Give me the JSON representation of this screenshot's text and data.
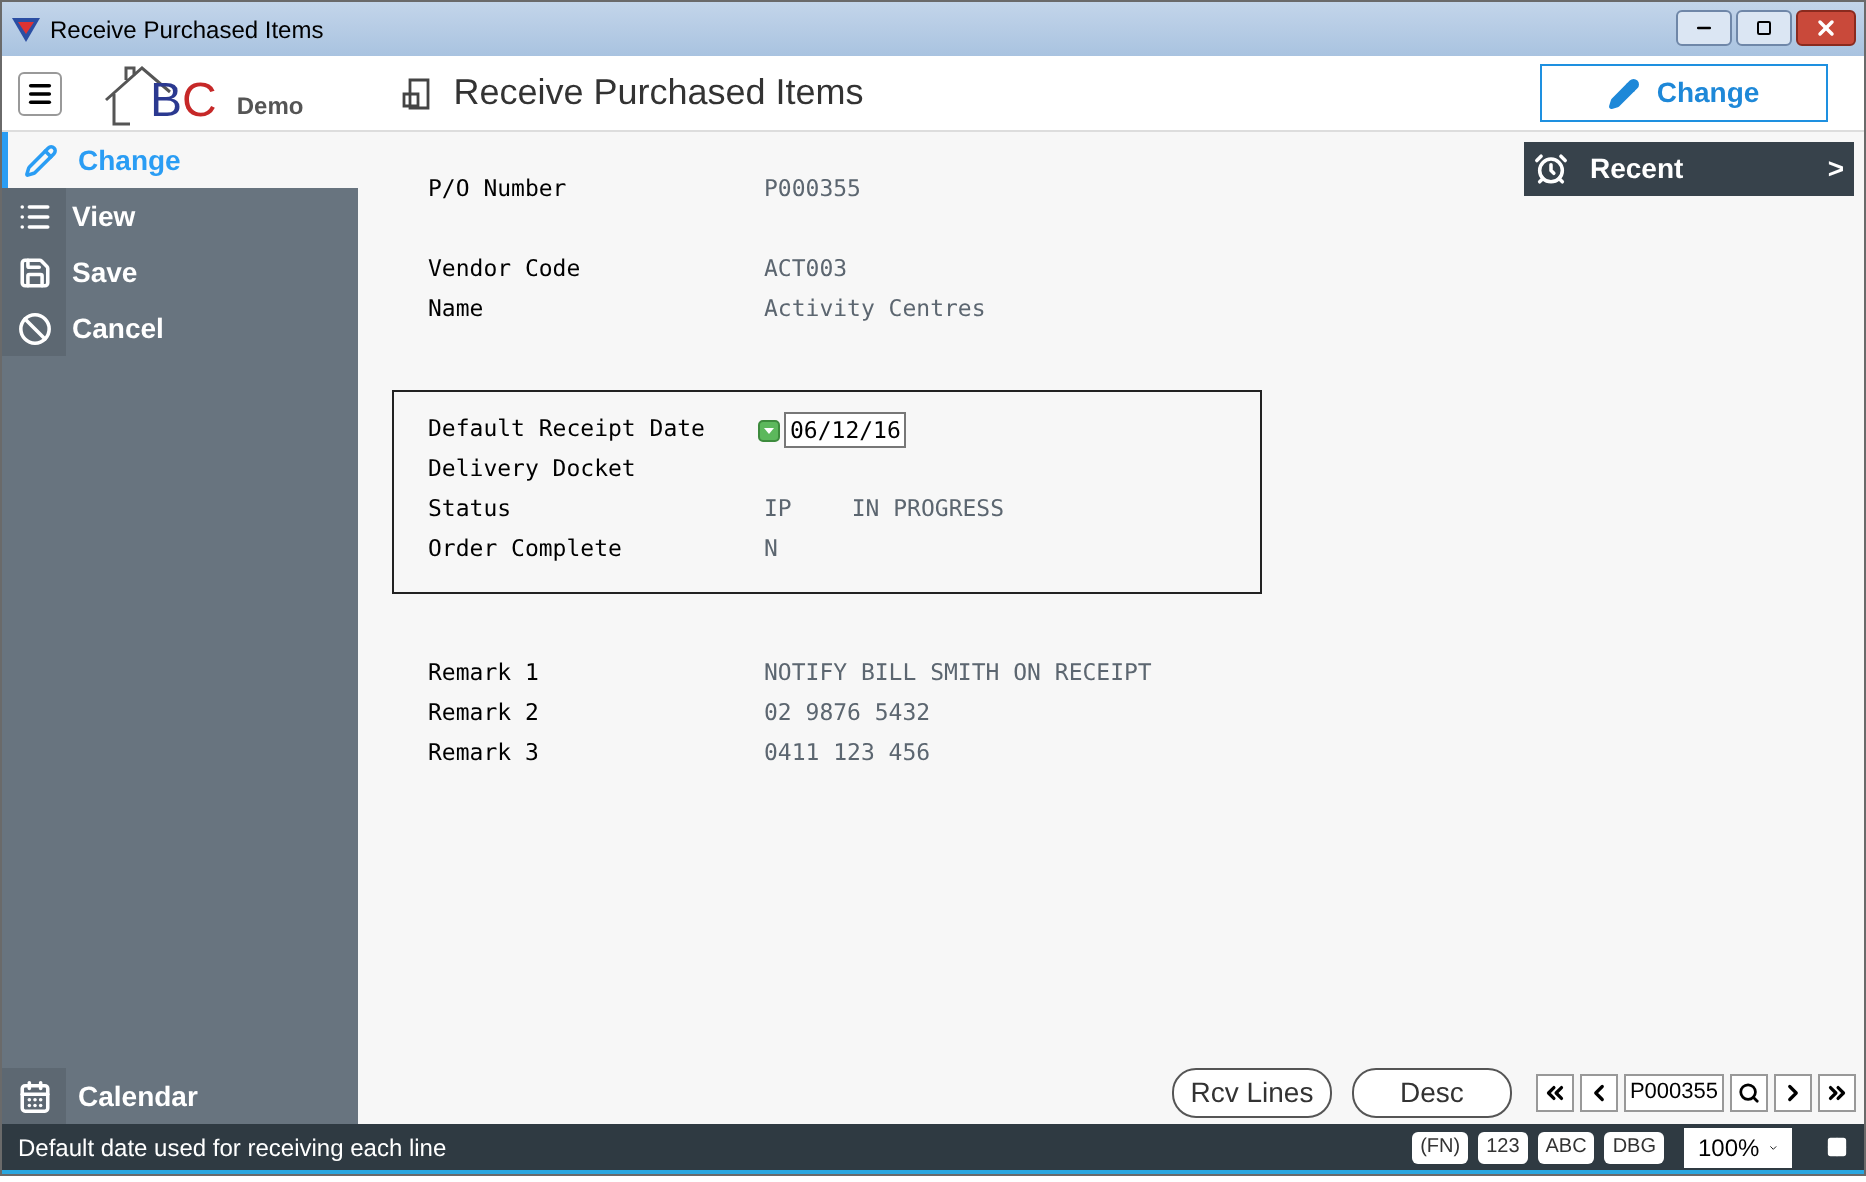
{
  "window": {
    "title": "Receive Purchased Items"
  },
  "header": {
    "logo_text": "BC",
    "logo_subtitle": "Demo",
    "page_title": "Receive Purchased Items",
    "action_button": "Change"
  },
  "sidebar": {
    "items": [
      {
        "label": "Change",
        "selected": true
      },
      {
        "label": "View",
        "selected": false
      },
      {
        "label": "Save",
        "selected": false
      },
      {
        "label": "Cancel",
        "selected": false
      }
    ],
    "bottom_item": {
      "label": "Calendar"
    }
  },
  "recent_panel": {
    "label": "Recent",
    "chevron": ">"
  },
  "sections": [
    {
      "boxed": false,
      "fields": [
        {
          "label": "P/O Number",
          "value": "P000355"
        }
      ]
    },
    {
      "boxed": false,
      "fields": [
        {
          "label": "Vendor Code",
          "value": "ACT003"
        },
        {
          "label": "Name",
          "value": "Activity Centres"
        }
      ]
    },
    {
      "boxed": true,
      "fields": [
        {
          "label": "Default Receipt Date",
          "kind": "date",
          "value": "06/12/16"
        },
        {
          "label": "Delivery Docket",
          "kind": "text"
        },
        {
          "label": "Status",
          "kind": "text",
          "value": "IP",
          "extra": "IN PROGRESS"
        },
        {
          "label": "Order Complete",
          "kind": "text",
          "value": "N"
        }
      ]
    },
    {
      "boxed": false,
      "fields": [
        {
          "label": "Remark 1",
          "value": "NOTIFY BILL SMITH ON RECEIPT"
        },
        {
          "label": "Remark 2",
          "value": "02 9876 5432"
        },
        {
          "label": "Remark 3",
          "value": "0411 123 456"
        }
      ]
    }
  ],
  "footer_buttons": [
    "Rcv Lines",
    "Desc"
  ],
  "navigator": {
    "value": "P000355"
  },
  "status_bar": {
    "message": "Default date used for receiving each line",
    "badges": [
      "(FN)",
      "123",
      "ABC",
      "DBG"
    ],
    "zoom": "100%"
  }
}
